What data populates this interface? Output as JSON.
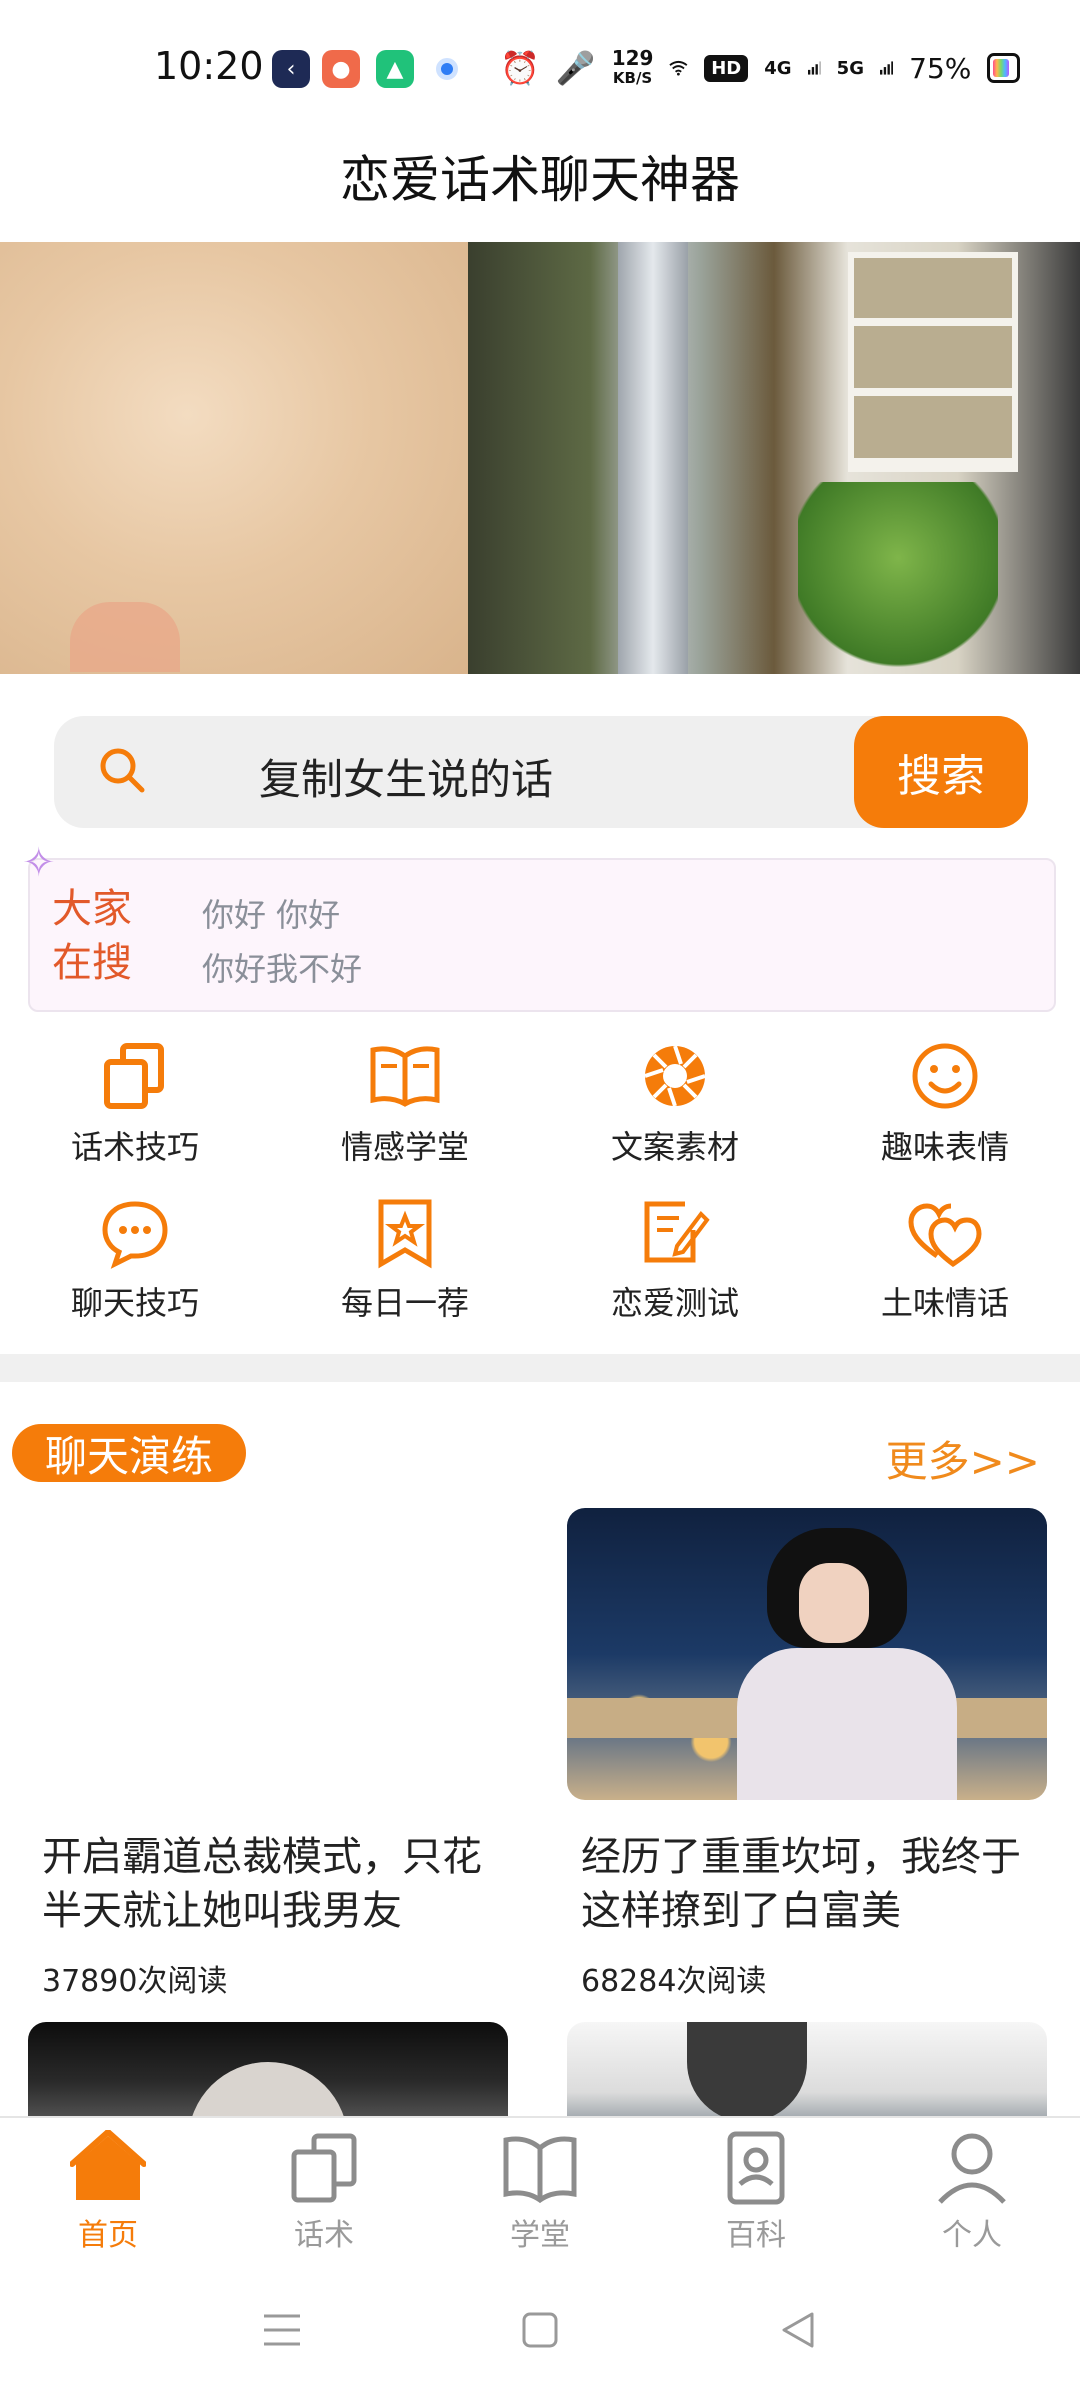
{
  "status_bar": {
    "time": "10:20",
    "net_speed_value": "129",
    "net_speed_unit": "KB/S",
    "hd_label": "HD",
    "net1": "4G",
    "net2": "5G",
    "battery": "75%",
    "icons": [
      "app-k-icon",
      "app-monkey-icon",
      "app-green-icon",
      "app-dot-icon",
      "alarm-icon",
      "mic-icon",
      "wifi-icon",
      "signal-icon"
    ]
  },
  "header": {
    "title": "恋爱话术聊天神器"
  },
  "banner": {
    "active_index": 0
  },
  "search": {
    "placeholder": "复制女生说的话",
    "button_label": "搜索"
  },
  "hot_search": {
    "label_line1": "大家",
    "label_line2": "在搜",
    "items": [
      "你好 你好",
      "你好我不好"
    ]
  },
  "categories": [
    {
      "label": "话术技巧",
      "icon": "copy-icon"
    },
    {
      "label": "情感学堂",
      "icon": "book-icon"
    },
    {
      "label": "文案素材",
      "icon": "aperture-icon"
    },
    {
      "label": "趣味表情",
      "icon": "smile-icon"
    },
    {
      "label": "聊天技巧",
      "icon": "chat-bubble-icon"
    },
    {
      "label": "每日一荐",
      "icon": "star-bookmark-icon"
    },
    {
      "label": "恋爱测试",
      "icon": "edit-note-icon"
    },
    {
      "label": "土味情话",
      "icon": "hearts-icon"
    }
  ],
  "section": {
    "tag": "聊天演练",
    "more": "更多>>",
    "articles": [
      {
        "title": "开启霸道总裁模式，只花半天就让她叫我男友",
        "reads": "37890次阅读"
      },
      {
        "title": "经历了重重坎坷，我终于这样撩到了白富美",
        "reads": "68284次阅读"
      }
    ]
  },
  "bottom_nav": [
    {
      "label": "首页",
      "icon": "home-icon",
      "active": true
    },
    {
      "label": "话术",
      "icon": "copy-icon",
      "active": false
    },
    {
      "label": "学堂",
      "icon": "book-icon",
      "active": false
    },
    {
      "label": "百科",
      "icon": "encyclopedia-icon",
      "active": false
    },
    {
      "label": "个人",
      "icon": "person-icon",
      "active": false
    }
  ],
  "colors": {
    "accent": "#f57c0a",
    "hot_label": "#e2592a",
    "muted": "#9a9a9a"
  }
}
